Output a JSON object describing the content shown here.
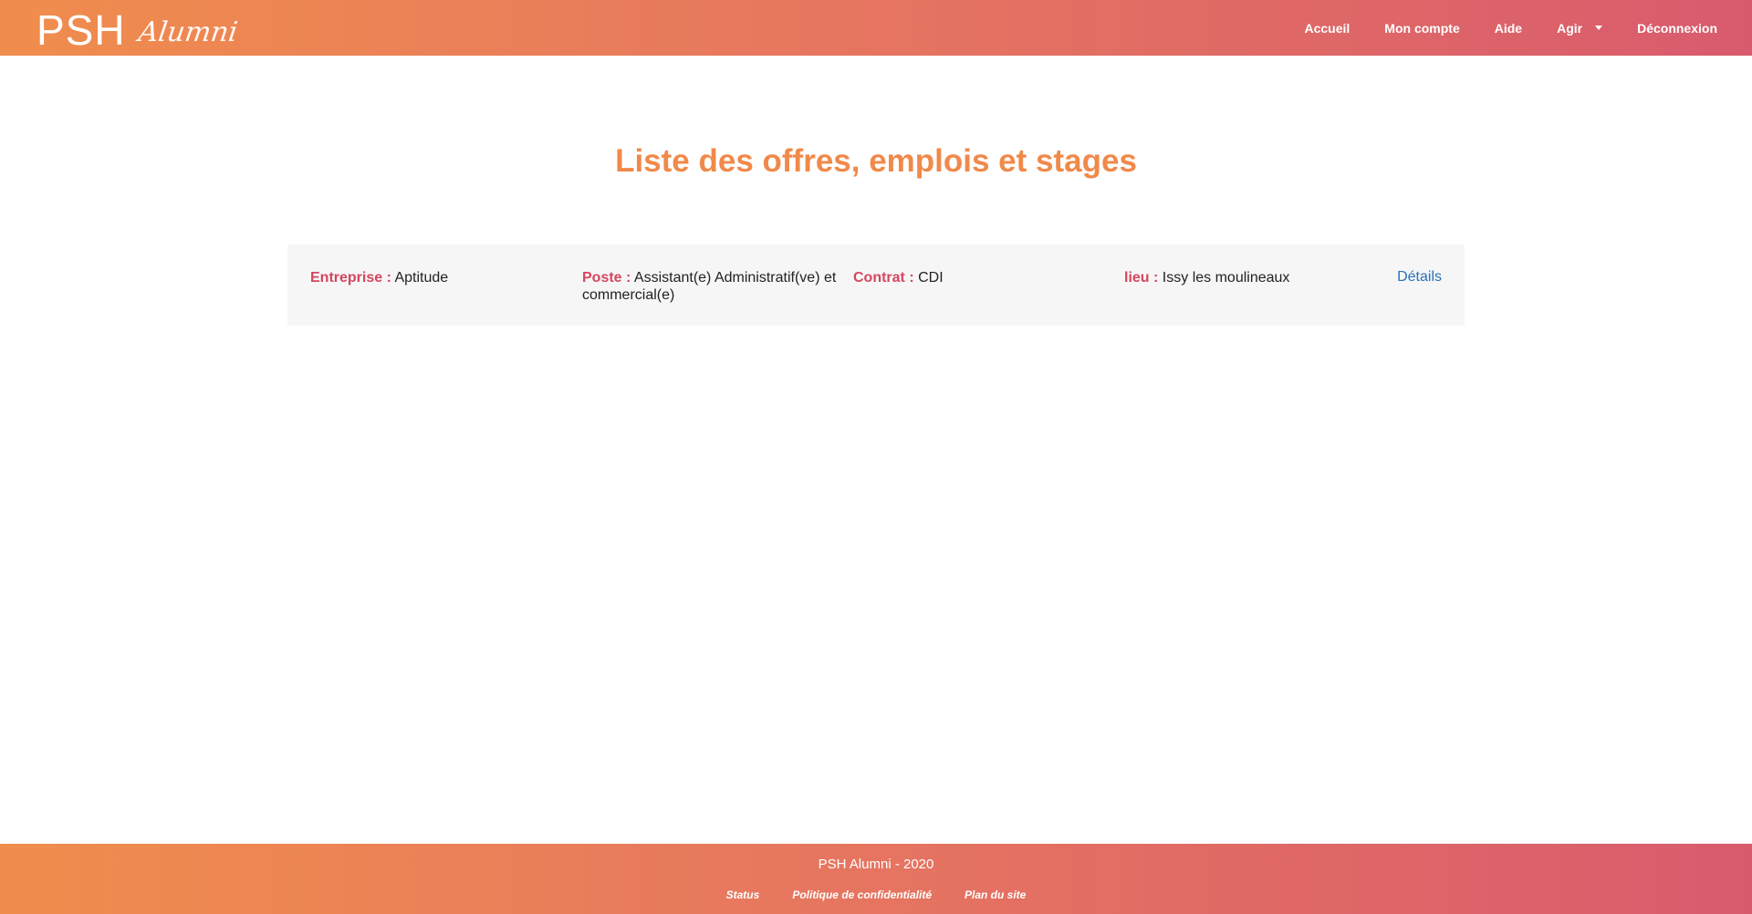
{
  "header": {
    "logo_main": "PSH",
    "logo_script": "Alumni",
    "nav": {
      "home": "Accueil",
      "account": "Mon compte",
      "help": "Aide",
      "act": "Agir",
      "logout": "Déconnexion"
    }
  },
  "main": {
    "title": "Liste des offres, emplois et stages",
    "offers": [
      {
        "company_label": "Entreprise :",
        "company": "Aptitude",
        "position_label": "Poste :",
        "position": "Assistant(e) Administratif(ve) et commercial(e)",
        "contract_label": "Contrat :",
        "contract": "CDI",
        "location_label": "lieu :",
        "location": "Issy les moulineaux",
        "details_label": "Détails"
      }
    ]
  },
  "footer": {
    "copyright": "PSH Alumni - 2020",
    "links": {
      "status": "Status",
      "privacy": "Politique de confidentialité",
      "sitemap": "Plan du site"
    }
  },
  "colors": {
    "gradient_start": "#f08d4d",
    "gradient_end": "#d85b6d",
    "title": "#f0894a",
    "label": "#d4475f",
    "link": "#2a71b8",
    "card_bg": "#f6f6f6"
  }
}
